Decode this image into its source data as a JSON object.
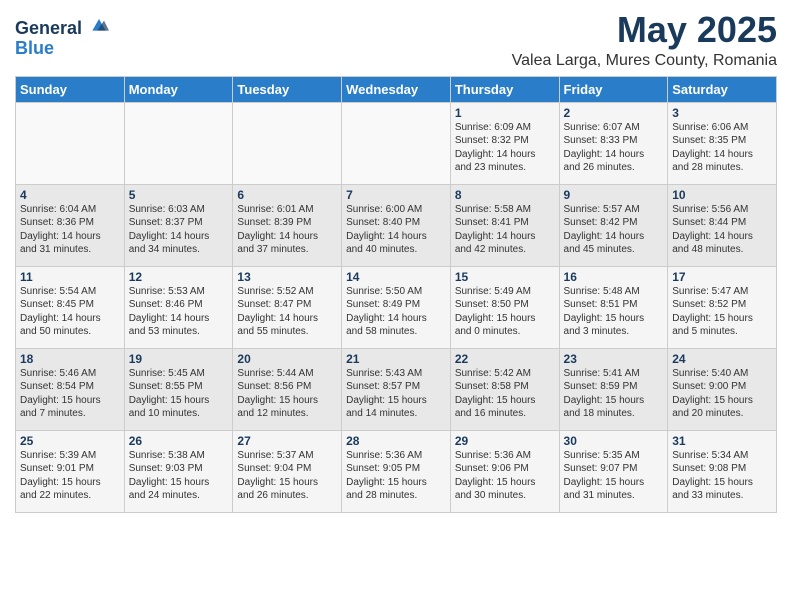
{
  "header": {
    "logo_line1": "General",
    "logo_line2": "Blue",
    "month": "May 2025",
    "location": "Valea Larga, Mures County, Romania"
  },
  "days_of_week": [
    "Sunday",
    "Monday",
    "Tuesday",
    "Wednesday",
    "Thursday",
    "Friday",
    "Saturday"
  ],
  "weeks": [
    [
      {
        "day": "",
        "info": ""
      },
      {
        "day": "",
        "info": ""
      },
      {
        "day": "",
        "info": ""
      },
      {
        "day": "",
        "info": ""
      },
      {
        "day": "1",
        "info": "Sunrise: 6:09 AM\nSunset: 8:32 PM\nDaylight: 14 hours\nand 23 minutes."
      },
      {
        "day": "2",
        "info": "Sunrise: 6:07 AM\nSunset: 8:33 PM\nDaylight: 14 hours\nand 26 minutes."
      },
      {
        "day": "3",
        "info": "Sunrise: 6:06 AM\nSunset: 8:35 PM\nDaylight: 14 hours\nand 28 minutes."
      }
    ],
    [
      {
        "day": "4",
        "info": "Sunrise: 6:04 AM\nSunset: 8:36 PM\nDaylight: 14 hours\nand 31 minutes."
      },
      {
        "day": "5",
        "info": "Sunrise: 6:03 AM\nSunset: 8:37 PM\nDaylight: 14 hours\nand 34 minutes."
      },
      {
        "day": "6",
        "info": "Sunrise: 6:01 AM\nSunset: 8:39 PM\nDaylight: 14 hours\nand 37 minutes."
      },
      {
        "day": "7",
        "info": "Sunrise: 6:00 AM\nSunset: 8:40 PM\nDaylight: 14 hours\nand 40 minutes."
      },
      {
        "day": "8",
        "info": "Sunrise: 5:58 AM\nSunset: 8:41 PM\nDaylight: 14 hours\nand 42 minutes."
      },
      {
        "day": "9",
        "info": "Sunrise: 5:57 AM\nSunset: 8:42 PM\nDaylight: 14 hours\nand 45 minutes."
      },
      {
        "day": "10",
        "info": "Sunrise: 5:56 AM\nSunset: 8:44 PM\nDaylight: 14 hours\nand 48 minutes."
      }
    ],
    [
      {
        "day": "11",
        "info": "Sunrise: 5:54 AM\nSunset: 8:45 PM\nDaylight: 14 hours\nand 50 minutes."
      },
      {
        "day": "12",
        "info": "Sunrise: 5:53 AM\nSunset: 8:46 PM\nDaylight: 14 hours\nand 53 minutes."
      },
      {
        "day": "13",
        "info": "Sunrise: 5:52 AM\nSunset: 8:47 PM\nDaylight: 14 hours\nand 55 minutes."
      },
      {
        "day": "14",
        "info": "Sunrise: 5:50 AM\nSunset: 8:49 PM\nDaylight: 14 hours\nand 58 minutes."
      },
      {
        "day": "15",
        "info": "Sunrise: 5:49 AM\nSunset: 8:50 PM\nDaylight: 15 hours\nand 0 minutes."
      },
      {
        "day": "16",
        "info": "Sunrise: 5:48 AM\nSunset: 8:51 PM\nDaylight: 15 hours\nand 3 minutes."
      },
      {
        "day": "17",
        "info": "Sunrise: 5:47 AM\nSunset: 8:52 PM\nDaylight: 15 hours\nand 5 minutes."
      }
    ],
    [
      {
        "day": "18",
        "info": "Sunrise: 5:46 AM\nSunset: 8:54 PM\nDaylight: 15 hours\nand 7 minutes."
      },
      {
        "day": "19",
        "info": "Sunrise: 5:45 AM\nSunset: 8:55 PM\nDaylight: 15 hours\nand 10 minutes."
      },
      {
        "day": "20",
        "info": "Sunrise: 5:44 AM\nSunset: 8:56 PM\nDaylight: 15 hours\nand 12 minutes."
      },
      {
        "day": "21",
        "info": "Sunrise: 5:43 AM\nSunset: 8:57 PM\nDaylight: 15 hours\nand 14 minutes."
      },
      {
        "day": "22",
        "info": "Sunrise: 5:42 AM\nSunset: 8:58 PM\nDaylight: 15 hours\nand 16 minutes."
      },
      {
        "day": "23",
        "info": "Sunrise: 5:41 AM\nSunset: 8:59 PM\nDaylight: 15 hours\nand 18 minutes."
      },
      {
        "day": "24",
        "info": "Sunrise: 5:40 AM\nSunset: 9:00 PM\nDaylight: 15 hours\nand 20 minutes."
      }
    ],
    [
      {
        "day": "25",
        "info": "Sunrise: 5:39 AM\nSunset: 9:01 PM\nDaylight: 15 hours\nand 22 minutes."
      },
      {
        "day": "26",
        "info": "Sunrise: 5:38 AM\nSunset: 9:03 PM\nDaylight: 15 hours\nand 24 minutes."
      },
      {
        "day": "27",
        "info": "Sunrise: 5:37 AM\nSunset: 9:04 PM\nDaylight: 15 hours\nand 26 minutes."
      },
      {
        "day": "28",
        "info": "Sunrise: 5:36 AM\nSunset: 9:05 PM\nDaylight: 15 hours\nand 28 minutes."
      },
      {
        "day": "29",
        "info": "Sunrise: 5:36 AM\nSunset: 9:06 PM\nDaylight: 15 hours\nand 30 minutes."
      },
      {
        "day": "30",
        "info": "Sunrise: 5:35 AM\nSunset: 9:07 PM\nDaylight: 15 hours\nand 31 minutes."
      },
      {
        "day": "31",
        "info": "Sunrise: 5:34 AM\nSunset: 9:08 PM\nDaylight: 15 hours\nand 33 minutes."
      }
    ]
  ]
}
